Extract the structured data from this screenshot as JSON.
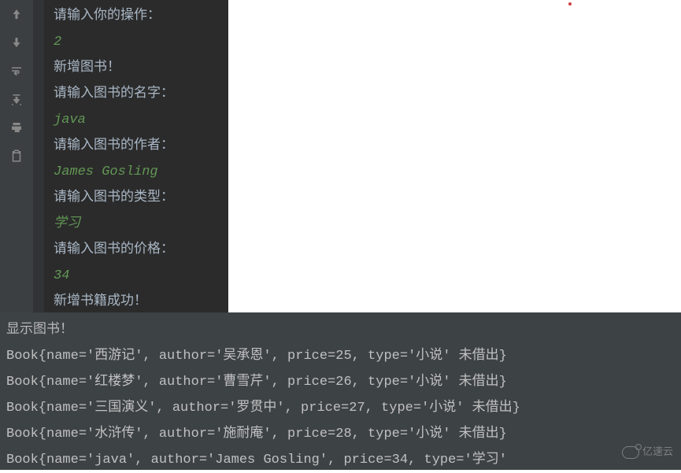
{
  "console": {
    "prompt_operation": "请输入你的操作：",
    "input_operation": "2",
    "add_book_title": "新增图书！",
    "prompt_name": "请输入图书的名字：",
    "input_name": "java",
    "prompt_author": "请输入图书的作者：",
    "input_author": "James Gosling",
    "prompt_type": "请输入图书的类型：",
    "input_type": "学习",
    "prompt_price": "请输入图书的价格：",
    "input_price": "34",
    "success": "新增书籍成功！"
  },
  "output": {
    "header": "显示图书！",
    "lines": [
      "Book{name='西游记', author='吴承恩', price=25, type='小说' 未借出}",
      "Book{name='红楼梦', author='曹雪芹', price=26, type='小说' 未借出}",
      "Book{name='三国演义', author='罗贯中', price=27, type='小说' 未借出}",
      "Book{name='水浒传', author='施耐庵', price=28, type='小说' 未借出}",
      "Book{name='java', author='James Gosling', price=34, type='学习'"
    ]
  },
  "watermark": {
    "text": "亿速云"
  },
  "toolbar": {
    "icons": [
      "arrow-up",
      "arrow-down",
      "wrap",
      "scroll-end",
      "print",
      "clipboard"
    ]
  }
}
